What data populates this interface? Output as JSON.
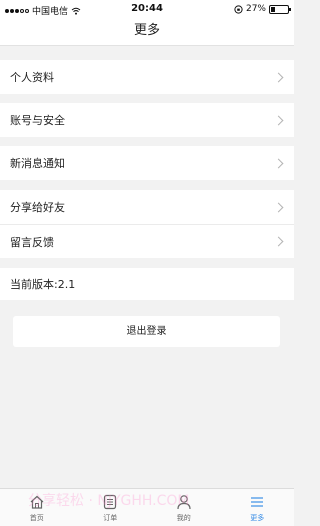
{
  "status_bar": {
    "carrier": "中国电信",
    "time": "20:44",
    "battery_percent": "27%",
    "battery_level": 0.27
  },
  "nav": {
    "title": "更多"
  },
  "menu": {
    "profile": "个人资料",
    "account_security": "账号与安全",
    "notifications": "新消息通知",
    "share": "分享给好友",
    "feedback": "留言反馈"
  },
  "version": {
    "text": "当前版本:2.1"
  },
  "logout_label": "退出登录",
  "tabs": [
    {
      "label": "首页",
      "icon": "home-icon"
    },
    {
      "label": "订单",
      "icon": "order-icon"
    },
    {
      "label": "我的",
      "icon": "user-icon"
    },
    {
      "label": "更多",
      "icon": "menu-icon",
      "active": true
    }
  ],
  "watermark": "分享轻松 · NJYGHH.COM",
  "colors": {
    "accent": "#3a8ee6",
    "background": "#f2f2f2"
  }
}
